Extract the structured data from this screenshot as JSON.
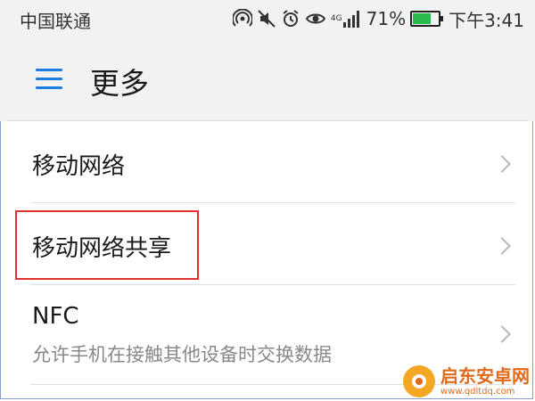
{
  "status_bar": {
    "carrier": "中国联通",
    "battery_percent": "71%",
    "battery_level": 0.71,
    "time": "下午3:41",
    "network_type": "4G",
    "icons": [
      "hotspot-icon",
      "mute-icon",
      "alarm-icon",
      "eye-comfort-icon",
      "signal-icon",
      "battery-icon"
    ]
  },
  "header": {
    "title": "更多",
    "menu_icon": "hamburger-menu-icon",
    "accent_color": "#1f7fe0"
  },
  "list": {
    "items": [
      {
        "title": "移动网络"
      },
      {
        "title": "移动网络共享"
      },
      {
        "title": "NFC",
        "subtitle": "允许手机在接触其他设备时交换数据"
      }
    ]
  },
  "watermark": {
    "name": "启东安卓网",
    "url": "www.qdltdq.com"
  }
}
